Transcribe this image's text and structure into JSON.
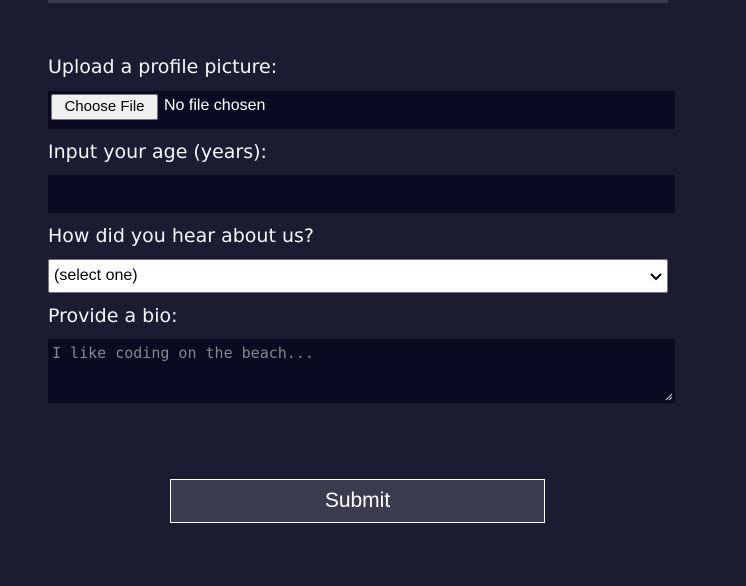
{
  "form": {
    "upload": {
      "label": "Upload a profile picture:",
      "button_label": "Choose File",
      "status": "No file chosen"
    },
    "age": {
      "label": "Input your age (years):",
      "value": ""
    },
    "referrer": {
      "label": "How did you hear about us?",
      "selected": "(select one)"
    },
    "bio": {
      "label": "Provide a bio:",
      "placeholder": "I like coding on the beach..."
    },
    "submit_label": "Submit"
  },
  "colors": {
    "background": "#1b1b32",
    "input_background": "#0a0a23",
    "button_background": "#3b3b4f",
    "text": "#f5f6f7"
  },
  "icons": {
    "select": "chevron-down-icon",
    "textarea": "resize-grip-icon"
  }
}
